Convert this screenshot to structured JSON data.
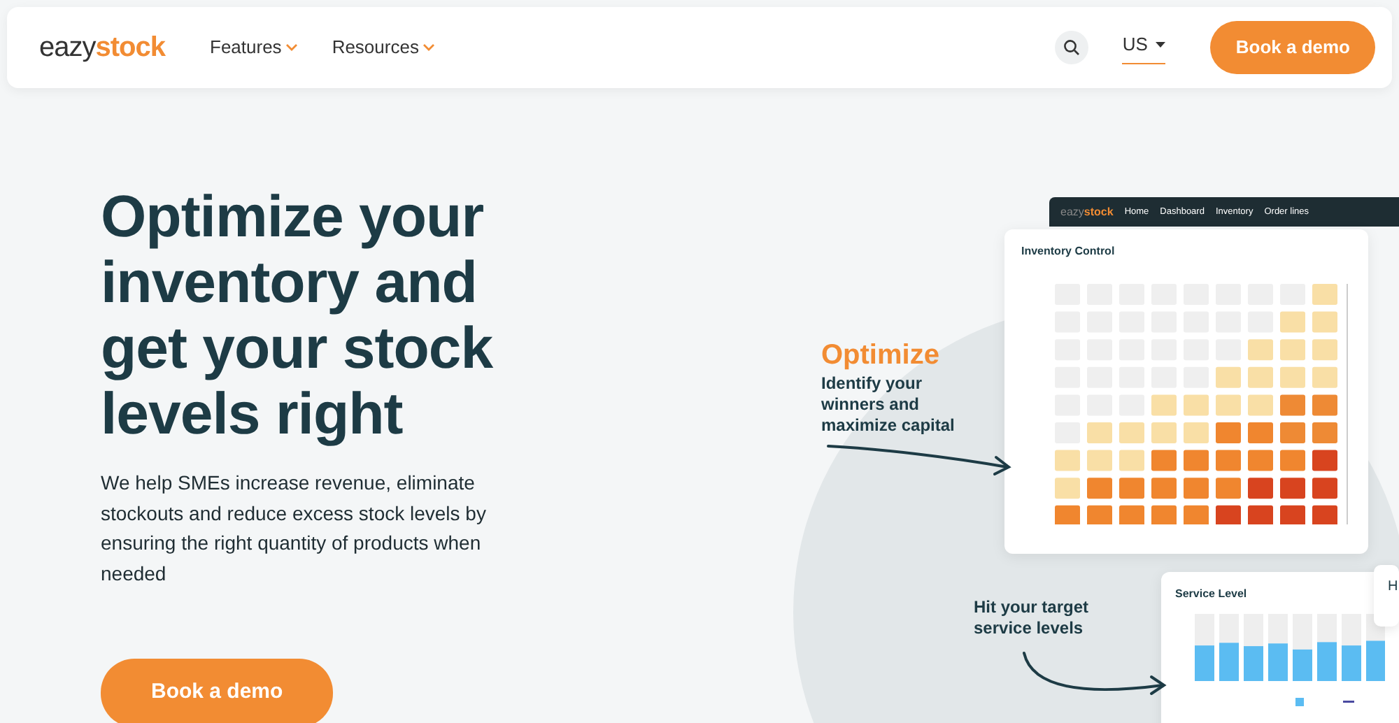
{
  "navbar": {
    "logo": {
      "part_1": "eazy",
      "part_2": "stock"
    },
    "menu": [
      {
        "label": "Features"
      },
      {
        "label": "Resources"
      }
    ],
    "region": "US",
    "cta": "Book a demo"
  },
  "hero": {
    "headline": "Optimize your inventory and get your stock levels right",
    "text": "We help SMEs increase revenue, eliminate stockouts and reduce excess stock levels by ensuring the right quantity of products when needed",
    "cta": "Book a demo"
  },
  "illustration": {
    "app_bar": {
      "logo": {
        "part_1": "eazy",
        "part_2": "stock"
      },
      "items": [
        {
          "label": "Home"
        },
        {
          "label": "Dashboard"
        },
        {
          "label": "Inventory"
        },
        {
          "label": "Order lines"
        }
      ]
    },
    "inventory_card": {
      "title": "Inventory Control"
    },
    "service_card": {
      "title": "Service Level"
    },
    "callouts": [
      {
        "title": "Optimize",
        "text": "Identify your winners and maximize capital"
      },
      {
        "text": "Hit your target service levels"
      }
    ],
    "popup": {
      "text": "H"
    }
  }
}
